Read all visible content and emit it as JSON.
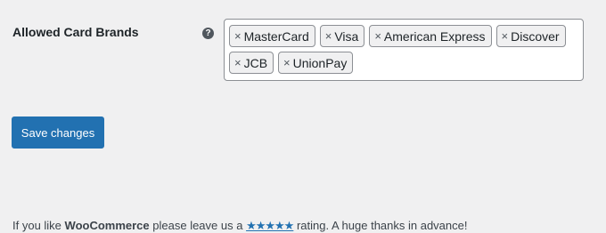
{
  "setting": {
    "label": "Allowed Card Brands",
    "help_icon": "question-circle-icon",
    "help_glyph": "?",
    "remove_glyph": "×",
    "selected_brands": [
      {
        "label": "MasterCard"
      },
      {
        "label": "Visa"
      },
      {
        "label": "American Express"
      },
      {
        "label": "Discover"
      },
      {
        "label": "JCB"
      },
      {
        "label": "UnionPay"
      }
    ]
  },
  "actions": {
    "save_label": "Save changes"
  },
  "footer": {
    "prefix": "If you like ",
    "brand": "WooCommerce",
    "middle": " please leave us a ",
    "stars": "★★★★★",
    "suffix": " rating. A huge thanks in advance!"
  },
  "colors": {
    "background": "#f0f0f1",
    "accent": "#2271b1",
    "text": "#1d2327"
  }
}
